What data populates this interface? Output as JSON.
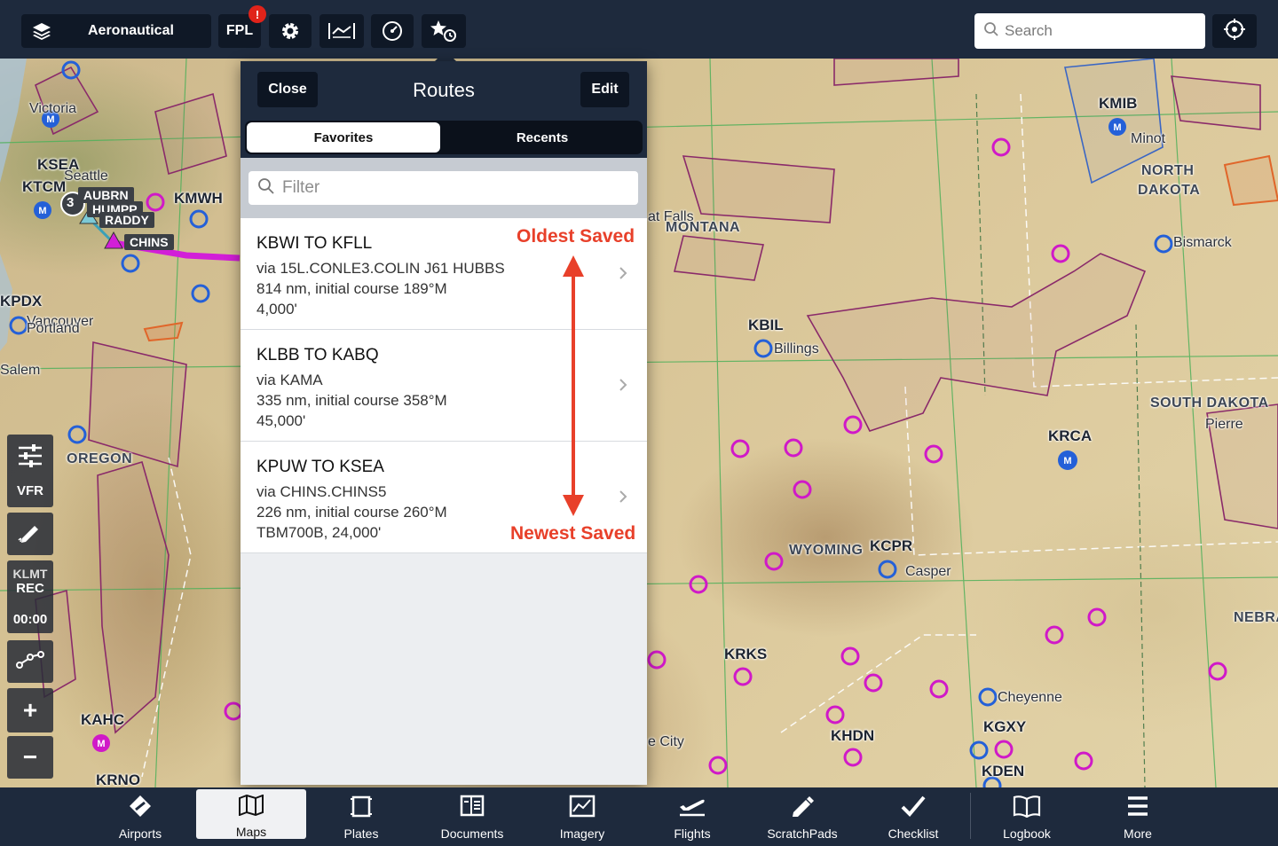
{
  "topbar": {
    "layer_label": "Aeronautical",
    "fpl_label": "FPL",
    "fpl_badge": "!",
    "search_placeholder": "Search"
  },
  "map": {
    "labels": [
      {
        "id": "victoria",
        "text": "Victoria"
      },
      {
        "id": "ksea",
        "text": "KSEA"
      },
      {
        "id": "seattle",
        "text": "Seattle"
      },
      {
        "id": "ktcm",
        "text": "KTCM"
      },
      {
        "id": "kmwh",
        "text": "KMWH"
      },
      {
        "id": "kpdx",
        "text": "KPDX"
      },
      {
        "id": "vancouver",
        "text": "Vancouver"
      },
      {
        "id": "portland",
        "text": "Portland"
      },
      {
        "id": "salem",
        "text": "Salem"
      },
      {
        "id": "oregon",
        "text": "OREGON"
      },
      {
        "id": "kahc",
        "text": "KAHC"
      },
      {
        "id": "krno",
        "text": "KRNO"
      },
      {
        "id": "greatfalls",
        "text": "at Falls"
      },
      {
        "id": "montana",
        "text": "MONTANA"
      },
      {
        "id": "kbil",
        "text": "KBIL"
      },
      {
        "id": "billings",
        "text": "Billings"
      },
      {
        "id": "kmib",
        "text": "KMIB"
      },
      {
        "id": "minot",
        "text": "Minot"
      },
      {
        "id": "northdakota1",
        "text": "NORTH"
      },
      {
        "id": "northdakota2",
        "text": "DAKOTA"
      },
      {
        "id": "bismarck",
        "text": "Bismarck"
      },
      {
        "id": "southdakota",
        "text": "SOUTH DAKOTA"
      },
      {
        "id": "pierre",
        "text": "Pierre"
      },
      {
        "id": "krca",
        "text": "KRCA"
      },
      {
        "id": "wyoming",
        "text": "WYOMING"
      },
      {
        "id": "kcpr",
        "text": "KCPR"
      },
      {
        "id": "casper",
        "text": "Casper"
      },
      {
        "id": "nebraska",
        "text": "NEBRA"
      },
      {
        "id": "krks",
        "text": "KRKS"
      },
      {
        "id": "khdn",
        "text": "KHDN"
      },
      {
        "id": "cheyenne",
        "text": "Cheyenne"
      },
      {
        "id": "kgxy",
        "text": "KGXY"
      },
      {
        "id": "kden",
        "text": "KDEN"
      },
      {
        "id": "saltlake",
        "text": "e City"
      }
    ],
    "waypoints": [
      "AUBRN",
      "HUMPP",
      "RADDY",
      "CHINS"
    ],
    "cluster_count": "3"
  },
  "side_controls": {
    "vfr": "VFR",
    "rec_station": "KLMT",
    "rec": "REC",
    "timer": "00:00",
    "zoom_in": "+",
    "zoom_out": "−"
  },
  "routes_panel": {
    "close_label": "Close",
    "title": "Routes",
    "edit_label": "Edit",
    "tabs": [
      "Favorites",
      "Recents"
    ],
    "active_tab": "Favorites",
    "filter_placeholder": "Filter",
    "routes": [
      {
        "title": "KBWI TO KFLL",
        "via": "via 15L.CONLE3.COLIN J61 HUBBS",
        "distance": "814 nm, initial course 189°M",
        "altitude": "4,000'"
      },
      {
        "title": "KLBB TO KABQ",
        "via": "via KAMA",
        "distance": "335 nm, initial course 358°M",
        "altitude": "45,000'"
      },
      {
        "title": "KPUW TO KSEA",
        "via": "via CHINS.CHINS5",
        "distance": "226 nm, initial course 260°M",
        "altitude": "TBM700B, 24,000'"
      }
    ]
  },
  "annotations": {
    "oldest": "Oldest Saved",
    "newest": "Newest Saved",
    "color": "#e8402a"
  },
  "tabbar": {
    "items": [
      {
        "label": "Airports",
        "icon": "airports-icon"
      },
      {
        "label": "Maps",
        "icon": "maps-icon"
      },
      {
        "label": "Plates",
        "icon": "plates-icon"
      },
      {
        "label": "Documents",
        "icon": "documents-icon"
      },
      {
        "label": "Imagery",
        "icon": "imagery-icon"
      },
      {
        "label": "Flights",
        "icon": "flights-icon"
      },
      {
        "label": "ScratchPads",
        "icon": "scratchpads-icon"
      },
      {
        "label": "Checklist",
        "icon": "checklist-icon"
      },
      {
        "label": "Logbook",
        "icon": "logbook-icon"
      },
      {
        "label": "More",
        "icon": "more-icon"
      }
    ],
    "active": "Maps"
  },
  "colors": {
    "bar_bg": "#1e2a3d",
    "airport_magenta": "#d019c8",
    "airport_blue": "#2460d8",
    "airspace": "#8a2a6a",
    "route_magenta": "#d21fd8"
  }
}
